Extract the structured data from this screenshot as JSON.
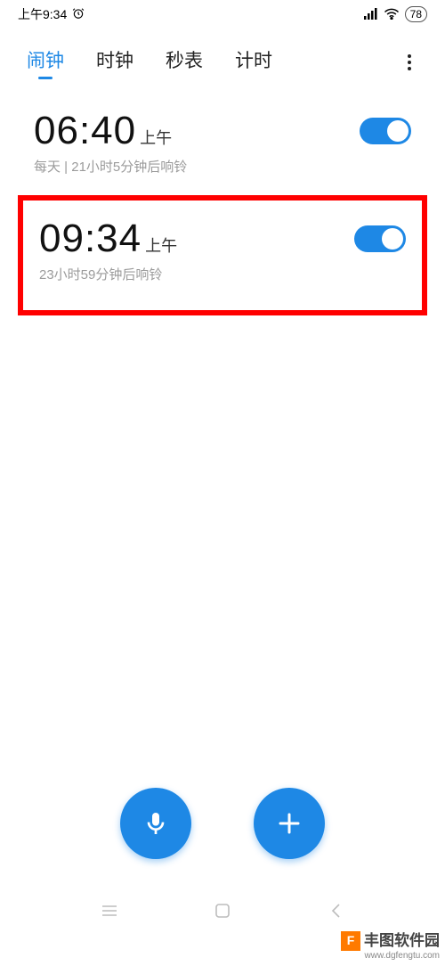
{
  "status": {
    "time": "上午9:34",
    "battery": "78"
  },
  "tabs": {
    "items": [
      "闹钟",
      "时钟",
      "秒表",
      "计时"
    ],
    "active_index": 0
  },
  "alarms": [
    {
      "time": "06:40",
      "ampm": "上午",
      "sub": "每天 | 21小时5分钟后响铃",
      "enabled": true
    },
    {
      "time": "09:34",
      "ampm": "上午",
      "sub": "23小时59分钟后响铃",
      "enabled": true
    }
  ],
  "watermark": {
    "text": "丰图软件园",
    "url": "www.dgfengtu.com"
  }
}
